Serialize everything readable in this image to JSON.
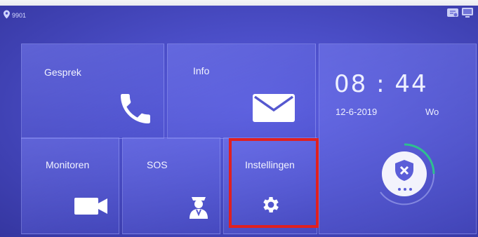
{
  "status_bar": {
    "room_number": "9901"
  },
  "tiles": {
    "call": {
      "label": "Gesprek"
    },
    "info": {
      "label": "Info"
    },
    "monitor": {
      "label": "Monitoren"
    },
    "sos": {
      "label": "SOS"
    },
    "settings": {
      "label": "Instellingen"
    }
  },
  "clock": {
    "time": "08 : 44",
    "date": "12-6-2019",
    "day": "Wo"
  },
  "colors": {
    "highlight": "#e02020",
    "accent_arc": "#2fbf8f"
  },
  "icons": [
    "location-pin-icon",
    "phone-icon",
    "envelope-icon",
    "video-camera-icon",
    "security-guard-icon",
    "gear-icon",
    "shield-icon",
    "network-icon",
    "monitor-icon"
  ]
}
